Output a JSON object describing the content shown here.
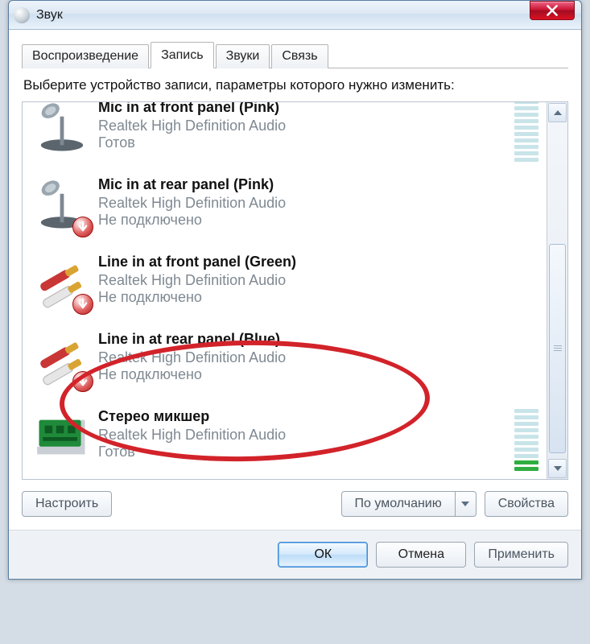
{
  "window": {
    "title": "Звук",
    "close_label": "Close"
  },
  "tabs": {
    "items": [
      {
        "label": "Воспроизведение"
      },
      {
        "label": "Запись"
      },
      {
        "label": "Звуки"
      },
      {
        "label": "Связь"
      }
    ],
    "active_index": 1
  },
  "instruction": "Выберите устройство записи, параметры которого нужно изменить:",
  "devices": [
    {
      "icon": "mic",
      "badge": "",
      "name": "Mic in at front panel (Pink)",
      "driver": "Realtek High Definition Audio",
      "status": "Готов",
      "meter": true,
      "level": 0
    },
    {
      "icon": "mic",
      "badge": "down",
      "name": "Mic in at rear panel (Pink)",
      "driver": "Realtek High Definition Audio",
      "status": "Не подключено",
      "meter": false,
      "level": 0
    },
    {
      "icon": "cable",
      "badge": "down",
      "name": "Line in at front panel (Green)",
      "driver": "Realtek High Definition Audio",
      "status": "Не подключено",
      "meter": false,
      "level": 0
    },
    {
      "icon": "cable",
      "badge": "down",
      "name": "Line in at rear panel (Blue)",
      "driver": "Realtek High Definition Audio",
      "status": "Не подключено",
      "meter": false,
      "level": 0
    },
    {
      "icon": "card",
      "badge": "",
      "name": "Стерео микшер",
      "driver": "Realtek High Definition Audio",
      "status": "Готов",
      "meter": true,
      "level": 2
    }
  ],
  "buttons": {
    "configure": "Настроить",
    "set_default": "По умолчанию",
    "properties": "Свойства",
    "ok": "ОК",
    "cancel": "Отмена",
    "apply": "Применить"
  },
  "annotation": {
    "target": "Стерео микшер",
    "shape": "ellipse",
    "color": "#d2232a"
  }
}
